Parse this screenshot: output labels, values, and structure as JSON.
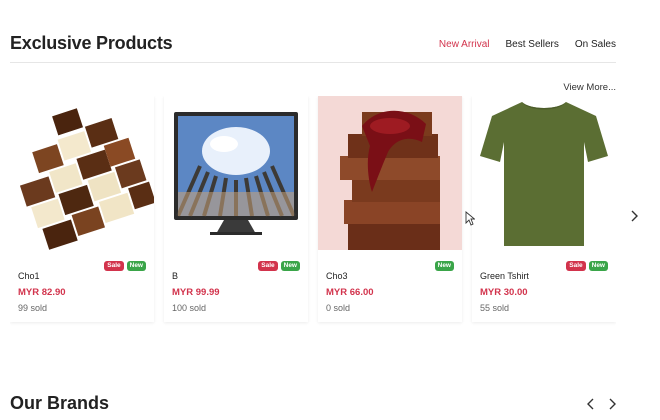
{
  "section": {
    "title": "Exclusive Products",
    "tabs": [
      {
        "label": "New Arrival",
        "active": true
      },
      {
        "label": "Best Sellers",
        "active": false
      },
      {
        "label": "On Sales",
        "active": false
      }
    ],
    "view_more": "View More..."
  },
  "products": [
    {
      "name": "Cho1",
      "price": "MYR 82.90",
      "sold": "99 sold",
      "badges": [
        "Sale",
        "New"
      ]
    },
    {
      "name": "B",
      "price": "MYR 99.99",
      "sold": "100 sold",
      "badges": [
        "Sale",
        "New"
      ]
    },
    {
      "name": "Cho3",
      "price": "MYR 66.00",
      "sold": "0 sold",
      "badges": [
        "New"
      ]
    },
    {
      "name": "Green Tshirt",
      "price": "MYR 30.00",
      "sold": "55 sold",
      "badges": [
        "Sale",
        "New"
      ]
    }
  ],
  "brands": {
    "title": "Our Brands"
  },
  "colors": {
    "accent": "#d2334c",
    "new_badge": "#3aa549",
    "sale_badge": "#d2334c"
  },
  "icons": {
    "next": "chevron-right-icon",
    "prev": "chevron-left-icon"
  }
}
